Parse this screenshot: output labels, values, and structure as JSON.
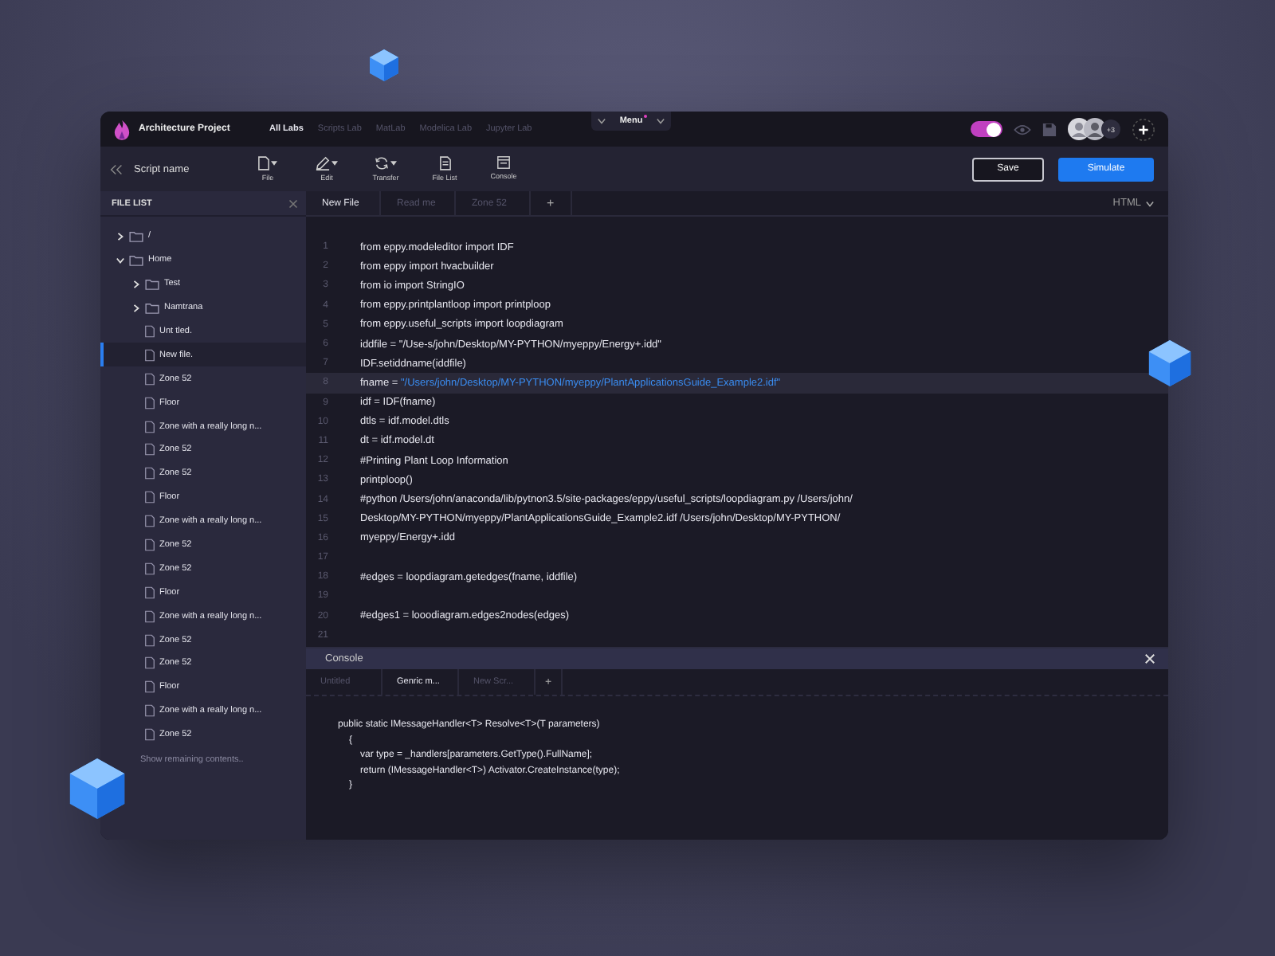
{
  "window": {
    "title": "Architecture Project"
  },
  "lab_tabs": [
    {
      "label": "All Labs",
      "selected": true
    },
    {
      "label": "Scripts Lab",
      "selected": false
    },
    {
      "label": "MatLab",
      "selected": false
    },
    {
      "label": "Modelica Lab",
      "selected": false
    },
    {
      "label": "Jupyter Lab",
      "selected": false
    }
  ],
  "menu": {
    "label": "Menu",
    "notification": true
  },
  "header": {
    "toggle_on": true,
    "extra_users": "+3"
  },
  "toolbar": {
    "script_name": "Script name",
    "tools": [
      {
        "label": "File",
        "kind": "file",
        "dropdown": true
      },
      {
        "label": "Edit",
        "kind": "edit",
        "dropdown": true
      },
      {
        "label": "Transfer",
        "kind": "transfer",
        "dropdown": true
      },
      {
        "label": "File List",
        "kind": "filelist",
        "dropdown": false
      },
      {
        "label": "Console",
        "kind": "console",
        "dropdown": false
      }
    ],
    "buttons": [
      {
        "label": "Save",
        "kind": "secondary"
      },
      {
        "label": "Simulate",
        "kind": "primary"
      }
    ]
  },
  "file_list": {
    "title": "FILE LIST",
    "tree": [
      {
        "name": "/",
        "kind": "folder",
        "expanded": false,
        "selected": false
      },
      {
        "name": "Home",
        "kind": "folder",
        "expanded": true,
        "selected": false,
        "children": [
          {
            "name": "Test",
            "kind": "folder",
            "expanded": false,
            "selected": false
          },
          {
            "name": "Namtrana",
            "kind": "folder",
            "expanded": false,
            "selected": false
          },
          {
            "name": "Unt tled.",
            "kind": "file",
            "selected": false
          },
          {
            "name": "New file.",
            "kind": "file",
            "selected": true
          },
          {
            "name": "Zone 52",
            "kind": "file",
            "selected": false
          },
          {
            "name": "Floor",
            "kind": "file",
            "selected": false
          },
          {
            "name": "Zone with a really long n...",
            "kind": "file",
            "selected": false
          },
          {
            "name": "Zone 52",
            "kind": "file",
            "selected": false
          },
          {
            "name": "Zone 52",
            "kind": "file",
            "selected": false
          },
          {
            "name": "Floor",
            "kind": "file",
            "selected": false
          },
          {
            "name": "Zone with a really long n...",
            "kind": "file",
            "selected": false
          },
          {
            "name": "Zone 52",
            "kind": "file",
            "selected": false
          },
          {
            "name": "Zone 52",
            "kind": "file",
            "selected": false
          },
          {
            "name": "Floor",
            "kind": "file",
            "selected": false
          },
          {
            "name": "Zone with a really long n...",
            "kind": "file",
            "selected": false
          },
          {
            "name": "Zone 52",
            "kind": "file",
            "selected": false
          },
          {
            "name": "Zone 52",
            "kind": "file",
            "selected": false
          },
          {
            "name": "Floor",
            "kind": "file",
            "selected": false
          },
          {
            "name": "Zone with a really long n...",
            "kind": "file",
            "selected": false
          },
          {
            "name": "Zone 52",
            "kind": "file",
            "selected": false
          }
        ]
      }
    ],
    "show_more": "Show remaining contents.."
  },
  "editor": {
    "tabs": [
      {
        "label": "New File",
        "selected": true
      },
      {
        "label": "Read me",
        "selected": false
      },
      {
        "label": "Zone 52",
        "selected": false
      }
    ],
    "add_tab": "+",
    "language": "HTML",
    "lines": [
      {
        "number": "1",
        "highlighted": false,
        "parts": [
          {
            "kind": "plain",
            "text": "from eppy.modeleditor import IDF"
          }
        ]
      },
      {
        "number": "2",
        "highlighted": false,
        "parts": [
          {
            "kind": "plain",
            "text": "from eppy import hvacbuilder"
          }
        ]
      },
      {
        "number": "3",
        "highlighted": false,
        "parts": [
          {
            "kind": "plain",
            "text": "from io import StringIO"
          }
        ]
      },
      {
        "number": "4",
        "highlighted": false,
        "parts": [
          {
            "kind": "plain",
            "text": "from eppy.printplantloop import printploop"
          }
        ]
      },
      {
        "number": "5",
        "highlighted": false,
        "parts": [
          {
            "kind": "plain",
            "text": "from eppy.useful_scripts import loopdiagram"
          }
        ]
      },
      {
        "number": "6",
        "highlighted": false,
        "parts": [
          {
            "kind": "plain",
            "text": "iddfile = \"/Use-s/john/Desktop/MY-PYTHON/myeppy/Energy+.idd\""
          }
        ]
      },
      {
        "number": "7",
        "highlighted": false,
        "parts": [
          {
            "kind": "plain",
            "text": "IDF.setiddname(iddfile)"
          }
        ]
      },
      {
        "number": "8",
        "highlighted": true,
        "parts": [
          {
            "kind": "plain",
            "text": "fname = "
          },
          {
            "kind": "string",
            "text": "\"/Users/john/Desktop/MY-PYTHON/myeppy/PlantApplicationsGuide_Example2.idf\""
          }
        ]
      },
      {
        "number": "9",
        "highlighted": false,
        "parts": [
          {
            "kind": "plain",
            "text": "idf = IDF(fname)"
          }
        ]
      },
      {
        "number": "10",
        "highlighted": false,
        "parts": [
          {
            "kind": "plain",
            "text": "dtls = idf.model.dtls"
          }
        ]
      },
      {
        "number": "11",
        "highlighted": false,
        "parts": [
          {
            "kind": "plain",
            "text": "dt = idf.model.dt"
          }
        ]
      },
      {
        "number": "12",
        "highlighted": false,
        "parts": [
          {
            "kind": "plain",
            "text": "#Printing Plant Loop Information"
          }
        ]
      },
      {
        "number": "13",
        "highlighted": false,
        "parts": [
          {
            "kind": "plain",
            "text": "printploop()"
          }
        ]
      },
      {
        "number": "14",
        "highlighted": false,
        "parts": [
          {
            "kind": "plain",
            "text": "#python /Users/john/anaconda/lib/pytnon3.5/site-packages/eppy/useful_scripts/loopdiagram.py /Users/john/"
          }
        ]
      },
      {
        "number": "15",
        "highlighted": false,
        "parts": [
          {
            "kind": "plain",
            "text": "Desktop/MY-PYTHON/myeppy/PlantApplicationsGuide_Example2.idf /Users/john/Desktop/MY-PYTHON/"
          }
        ]
      },
      {
        "number": "16",
        "highlighted": false,
        "parts": [
          {
            "kind": "plain",
            "text": "myeppy/Energy+.idd"
          }
        ]
      },
      {
        "number": "17",
        "highlighted": false
      },
      {
        "number": "18",
        "highlighted": false,
        "parts": [
          {
            "kind": "plain",
            "text": "#edges = loopdiagram.getedges(fname, iddfile)"
          }
        ]
      },
      {
        "number": "19",
        "highlighted": false
      },
      {
        "number": "20",
        "highlighted": false,
        "parts": [
          {
            "kind": "plain",
            "text": "#edges1 = looodiagram.edges2nodes(edges)"
          }
        ]
      },
      {
        "number": "21",
        "highlighted": false
      }
    ]
  },
  "console": {
    "title": "Console",
    "tabs": [
      {
        "label": "Untitled",
        "selected": false
      },
      {
        "label": "Genric m...",
        "selected": true
      },
      {
        "label": "New Scr...",
        "selected": false
      }
    ],
    "add_tab": "+",
    "lines": [
      {
        "text": "public static IMessageHandler<T> Resolve<T>(T parameters)",
        "children": [
          {
            "text": "{",
            "children": [
              {
                "text": "var type = _handlers[parameters.GetType().FullName];"
              },
              {
                "text": "return (IMessageHandler<T>) Activator.CreateInstance(type);"
              }
            ]
          },
          {
            "text": "}"
          }
        ]
      }
    ]
  }
}
